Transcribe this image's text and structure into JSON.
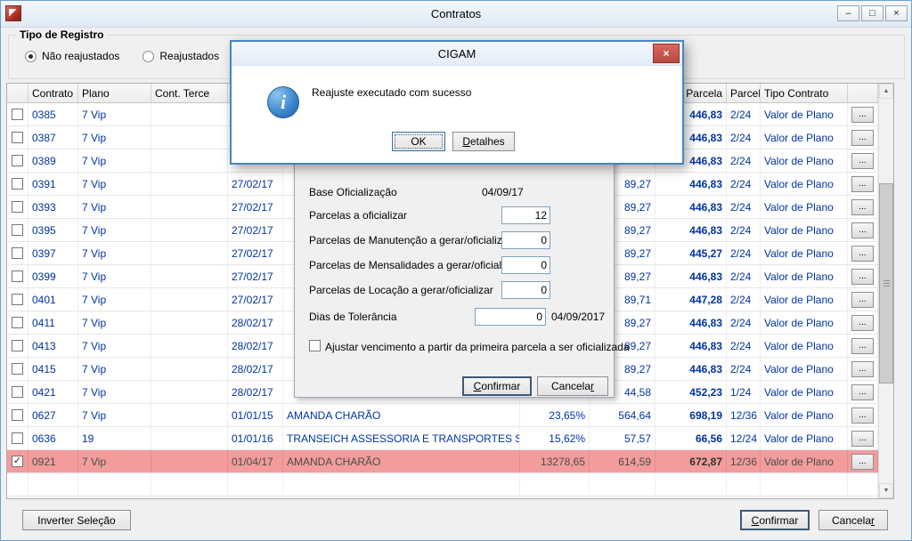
{
  "colors": {
    "accent_border": "#4287c7",
    "selected_row_bg": "#f29c9c",
    "grid_text": "#0033a0",
    "close_button_red": "#cd5b55"
  },
  "icons": {
    "minimize": "–",
    "maximize": "□",
    "close": "×",
    "info": "i",
    "scroll_up": "▲",
    "scroll_down": "▼",
    "check": "✓",
    "row_action": "..."
  },
  "window": {
    "title": "Contratos"
  },
  "filter": {
    "group_label": "Tipo de Registro",
    "option_nao_reajustados": "Não reajustados",
    "option_reajustados": "Reajustados"
  },
  "grid": {
    "headers": [
      "",
      "Contrato",
      "Plano",
      "Cont. Terce",
      "",
      "",
      "",
      "",
      "Valor Parcela",
      "Parcelas",
      "Tipo Contrato",
      ""
    ],
    "rows": [
      {
        "checked": false,
        "selected": false,
        "contrato": "0385",
        "plano": "7 Vip",
        "terce": "",
        "data": "",
        "cliente": "",
        "pct": "",
        "valor": "",
        "vparcela": "446,83",
        "parcelas": "2/24",
        "tipo": "Valor de Plano"
      },
      {
        "checked": false,
        "selected": false,
        "contrato": "0387",
        "plano": "7 Vip",
        "terce": "",
        "data": "",
        "cliente": "",
        "pct": "",
        "valor": "",
        "vparcela": "446,83",
        "parcelas": "2/24",
        "tipo": "Valor de Plano"
      },
      {
        "checked": false,
        "selected": false,
        "contrato": "0389",
        "plano": "7 Vip",
        "terce": "",
        "data": "",
        "cliente": "",
        "pct": "",
        "valor": "",
        "vparcela": "446,83",
        "parcelas": "2/24",
        "tipo": "Valor de Plano"
      },
      {
        "checked": false,
        "selected": false,
        "contrato": "0391",
        "plano": "7 Vip",
        "terce": "",
        "data": "27/02/17",
        "cliente": "",
        "pct": "",
        "valor": "89,27",
        "vparcela": "446,83",
        "parcelas": "2/24",
        "tipo": "Valor de Plano"
      },
      {
        "checked": false,
        "selected": false,
        "contrato": "0393",
        "plano": "7 Vip",
        "terce": "",
        "data": "27/02/17",
        "cliente": "",
        "pct": "",
        "valor": "89,27",
        "vparcela": "446,83",
        "parcelas": "2/24",
        "tipo": "Valor de Plano"
      },
      {
        "checked": false,
        "selected": false,
        "contrato": "0395",
        "plano": "7 Vip",
        "terce": "",
        "data": "27/02/17",
        "cliente": "",
        "pct": "",
        "valor": "89,27",
        "vparcela": "446,83",
        "parcelas": "2/24",
        "tipo": "Valor de Plano"
      },
      {
        "checked": false,
        "selected": false,
        "contrato": "0397",
        "plano": "7 Vip",
        "terce": "",
        "data": "27/02/17",
        "cliente": "",
        "pct": "",
        "valor": "89,27",
        "vparcela": "445,27",
        "parcelas": "2/24",
        "tipo": "Valor de Plano"
      },
      {
        "checked": false,
        "selected": false,
        "contrato": "0399",
        "plano": "7 Vip",
        "terce": "",
        "data": "27/02/17",
        "cliente": "",
        "pct": "",
        "valor": "89,27",
        "vparcela": "446,83",
        "parcelas": "2/24",
        "tipo": "Valor de Plano"
      },
      {
        "checked": false,
        "selected": false,
        "contrato": "0401",
        "plano": "7 Vip",
        "terce": "",
        "data": "27/02/17",
        "cliente": "",
        "pct": "",
        "valor": "89,71",
        "vparcela": "447,28",
        "parcelas": "2/24",
        "tipo": "Valor de Plano"
      },
      {
        "checked": false,
        "selected": false,
        "contrato": "0411",
        "plano": "7 Vip",
        "terce": "",
        "data": "28/02/17",
        "cliente": "",
        "pct": "",
        "valor": "89,27",
        "vparcela": "446,83",
        "parcelas": "2/24",
        "tipo": "Valor de Plano"
      },
      {
        "checked": false,
        "selected": false,
        "contrato": "0413",
        "plano": "7 Vip",
        "terce": "",
        "data": "28/02/17",
        "cliente": "",
        "pct": "",
        "valor": "89,27",
        "vparcela": "446,83",
        "parcelas": "2/24",
        "tipo": "Valor de Plano"
      },
      {
        "checked": false,
        "selected": false,
        "contrato": "0415",
        "plano": "7 Vip",
        "terce": "",
        "data": "28/02/17",
        "cliente": "",
        "pct": "",
        "valor": "89,27",
        "vparcela": "446,83",
        "parcelas": "2/24",
        "tipo": "Valor de Plano"
      },
      {
        "checked": false,
        "selected": false,
        "contrato": "0421",
        "plano": "7 Vip",
        "terce": "",
        "data": "28/02/17",
        "cliente": "",
        "pct": "",
        "valor": "44,58",
        "vparcela": "452,23",
        "parcelas": "1/24",
        "tipo": "Valor de Plano"
      },
      {
        "checked": false,
        "selected": false,
        "contrato": "0627",
        "plano": "7 Vip",
        "terce": "",
        "data": "01/01/15",
        "cliente": "AMANDA CHARÃO",
        "pct": "23,65%",
        "valor": "564,64",
        "vparcela": "698,19",
        "parcelas": "12/36",
        "tipo": "Valor de Plano"
      },
      {
        "checked": false,
        "selected": false,
        "contrato": "0636",
        "plano": "19",
        "terce": "",
        "data": "01/01/16",
        "cliente": "TRANSEICH ASSESSORIA E TRANSPORTES S,",
        "pct": "15,62%",
        "valor": "57,57",
        "vparcela": "66,56",
        "parcelas": "12/24",
        "tipo": "Valor de Plano"
      },
      {
        "checked": true,
        "selected": true,
        "contrato": "0921",
        "plano": "7 Vip",
        "terce": "",
        "data": "01/04/17",
        "cliente": "AMANDA CHARÃO",
        "pct": "13278,65",
        "valor": "614,59",
        "vparcela": "672,87",
        "parcelas": "12/36",
        "tipo": "Valor de Plano"
      }
    ]
  },
  "footer": {
    "invert_label": "Inverter Seleção",
    "confirm": {
      "pre": "",
      "key": "C",
      "post": "onfirmar"
    },
    "cancel": {
      "pre": "Cancela",
      "key": "r",
      "post": ""
    }
  },
  "reajuste_dialog": {
    "base_label": "Base Oficialização",
    "base_value": "04/09/17",
    "parcelas_label": "Parcelas a oficializar",
    "parcelas_value": "12",
    "manutencao_label": "Parcelas de Manutenção a gerar/oficializar",
    "manutencao_value": "0",
    "mensalidades_label": "Parcelas de Mensalidades a gerar/oficializar",
    "mensalidades_value": "0",
    "locacao_label": "Parcelas de Locação a gerar/oficializar",
    "locacao_value": "0",
    "tolerancia_label": "Dias de Tolerância",
    "tolerancia_value": "0",
    "tolerancia_date": "04/09/2017",
    "ajustar_checkbox_label": "Ajustar vencimento a partir da primeira parcela a ser oficializada",
    "confirm": {
      "pre": "",
      "key": "C",
      "post": "onfirmar"
    },
    "cancel": {
      "pre": "Cancela",
      "key": "r",
      "post": ""
    }
  },
  "message_dialog": {
    "title": "CIGAM",
    "message": "Reajuste executado com sucesso",
    "ok_label": "OK",
    "details": {
      "pre": "",
      "key": "D",
      "post": "etalhes"
    }
  }
}
